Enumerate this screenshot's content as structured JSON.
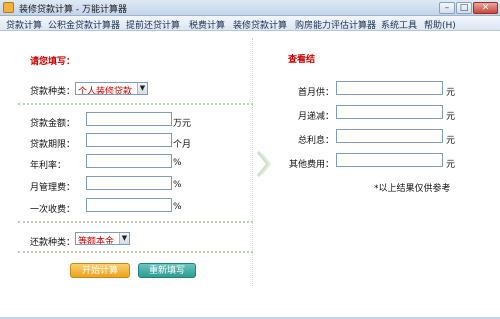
{
  "window": {
    "title": "装修贷款计算 - 万能计算器",
    "buttons": {
      "minimize": "–",
      "maximize": "□",
      "close": "✕"
    }
  },
  "menu": [
    "贷款计算",
    "公积金贷款计算器",
    "提前还贷计算",
    "税费计算",
    "装修贷款计算",
    "购房能力评估计算器",
    "系统工具",
    "帮助(H)"
  ],
  "left": {
    "section_title": "请您填写：",
    "loan_type": {
      "label": "贷款种类：",
      "value": "个人装修贷款"
    },
    "fields": [
      {
        "label": "贷款金额：",
        "value": "",
        "unit": "万元"
      },
      {
        "label": "贷款期限：",
        "value": "",
        "unit": "个月"
      },
      {
        "label": "年利率：",
        "value": "",
        "unit": "%"
      },
      {
        "label": "月管理费：",
        "value": "",
        "unit": "%"
      },
      {
        "label": "一次收费：",
        "value": "",
        "unit": "%"
      }
    ],
    "repay_type": {
      "label": "还款种类：",
      "value": "等额本金"
    },
    "start_button": "开始计算",
    "reset_button": "重新填写"
  },
  "right": {
    "section_title": "查看结",
    "results": [
      {
        "label": "首月供：",
        "value": "",
        "unit": "元"
      },
      {
        "label": "月递减：",
        "value": "",
        "unit": "元"
      },
      {
        "label": "总利息：",
        "value": "",
        "unit": "元"
      },
      {
        "label": "其他费用：",
        "value": "",
        "unit": "元"
      }
    ],
    "note": "*以上结果仅供参考"
  },
  "colors": {
    "accent_red": "#cc0000",
    "orange_button": "#eea21c",
    "teal_button": "#2f9b95"
  },
  "icons": {
    "app": "calculator-icon",
    "divider": "chevron-right-icon",
    "dropdown": "chevron-down-icon"
  }
}
